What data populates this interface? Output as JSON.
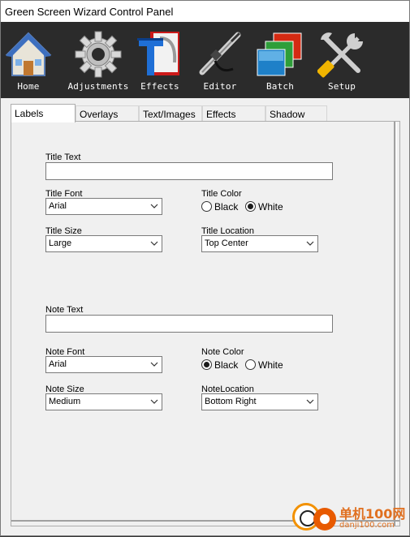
{
  "window": {
    "title": "Green Screen Wizard Control Panel"
  },
  "toolbar": {
    "items": [
      {
        "label": "Home",
        "icon": "home-icon"
      },
      {
        "label": "Adjustments",
        "icon": "gear-icon"
      },
      {
        "label": "Effects",
        "icon": "effects-icon"
      },
      {
        "label": "Editor",
        "icon": "airbrush-icon"
      },
      {
        "label": "Batch",
        "icon": "batch-icon"
      },
      {
        "label": "Setup",
        "icon": "tools-icon"
      }
    ]
  },
  "tabs": [
    "Labels",
    "Overlays",
    "Text/Images",
    "Effects",
    "Shadow"
  ],
  "labels_tab": {
    "title_text": {
      "label": "Title Text",
      "value": ""
    },
    "title_font": {
      "label": "Title Font",
      "value": "Arial"
    },
    "title_color": {
      "label": "Title Color",
      "options": [
        "Black",
        "White"
      ],
      "selected": "White"
    },
    "title_size": {
      "label": "Title Size",
      "value": "Large"
    },
    "title_location": {
      "label": "Title Location",
      "value": "Top Center"
    },
    "note_text": {
      "label": "Note Text",
      "value": ""
    },
    "note_font": {
      "label": "Note Font",
      "value": "Arial"
    },
    "note_color": {
      "label": "Note Color",
      "options": [
        "Black",
        "White"
      ],
      "selected": "Black"
    },
    "note_size": {
      "label": "Note Size",
      "value": "Medium"
    },
    "note_location": {
      "label": "NoteLocation",
      "value": "Bottom Right"
    }
  },
  "watermark": {
    "text": "单机100网",
    "sub": "danji100.com"
  }
}
